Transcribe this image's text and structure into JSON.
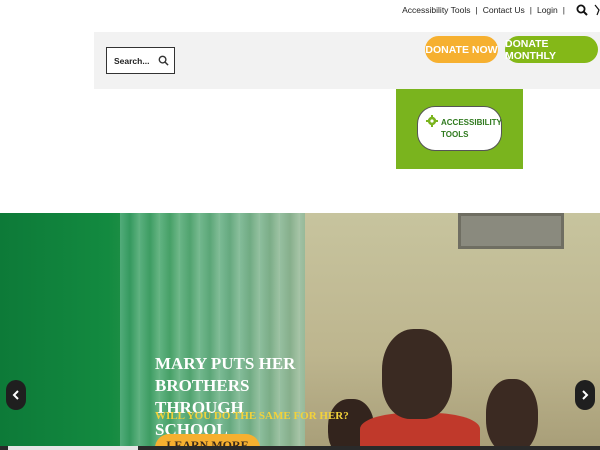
{
  "utility_nav": {
    "accessibility": "Accessibility Tools",
    "sep1": "|",
    "contact": "Contact Us",
    "sep2": "|",
    "login": "Login",
    "sep3": "|"
  },
  "search": {
    "placeholder": "Search..."
  },
  "donate": {
    "now": "DONATE NOW",
    "monthly": "DONATE MONTHLY"
  },
  "accessibility_tools": {
    "label": "ACCESSIBILITY TOOLS"
  },
  "hero": {
    "title": "MARY PUTS HER BROTHERS THROUGH SCHOOL",
    "subtitle": "WILL YOU DO THE SAME FOR HER?",
    "cta": "LEARN MORE"
  },
  "colors": {
    "donate_now": "#f6b030",
    "donate_monthly": "#84b818",
    "accessibility_panel": "#7ab41e",
    "hero_green": "#0d7a38",
    "subtitle_yellow": "#f2d23a"
  },
  "icons": [
    "search-icon",
    "gear-icon",
    "chevron-left-icon",
    "chevron-right-icon"
  ]
}
